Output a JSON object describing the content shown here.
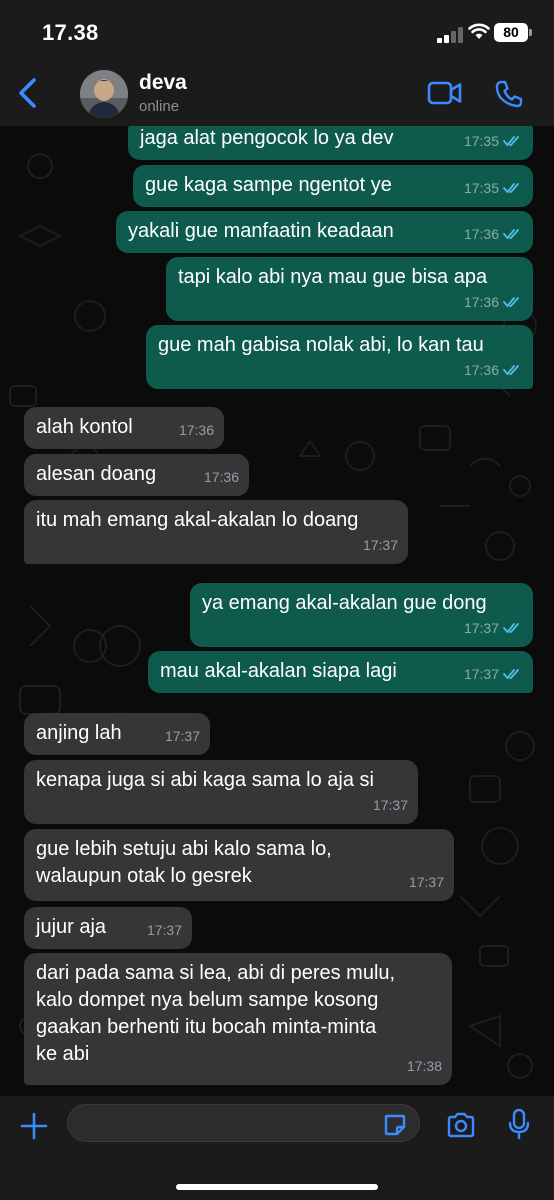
{
  "status_bar": {
    "time": "17.38",
    "battery": "80"
  },
  "header": {
    "contact_name": "deva",
    "contact_status": "online"
  },
  "messages": [
    {
      "dir": "out",
      "text": "jaga alat pengocok lo ya dev",
      "time": "17:35",
      "read": true
    },
    {
      "dir": "out",
      "text": "gue kaga sampe ngentot ye",
      "time": "17:35",
      "read": true
    },
    {
      "dir": "out",
      "text": "yakali gue manfaatin keadaan",
      "time": "17:36",
      "read": true
    },
    {
      "dir": "out",
      "text": "tapi kalo abi nya mau gue bisa apa",
      "time": "17:36",
      "read": true
    },
    {
      "dir": "out",
      "text": "gue mah gabisa nolak abi, lo kan tau",
      "time": "17:36",
      "read": true
    },
    {
      "dir": "in",
      "text": "alah kontol",
      "time": "17:36"
    },
    {
      "dir": "in",
      "text": "alesan doang",
      "time": "17:36"
    },
    {
      "dir": "in",
      "text": "itu mah emang akal-akalan lo doang",
      "time": "17:37"
    },
    {
      "dir": "out",
      "text": "ya emang akal-akalan gue dong",
      "time": "17:37",
      "read": true
    },
    {
      "dir": "out",
      "text": "mau akal-akalan siapa lagi",
      "time": "17:37",
      "read": true
    },
    {
      "dir": "in",
      "text": "anjing lah",
      "time": "17:37"
    },
    {
      "dir": "in",
      "text": "kenapa juga si abi kaga sama lo aja si",
      "time": "17:37"
    },
    {
      "dir": "in",
      "text": "gue lebih setuju abi kalo sama lo,\nwalaupun otak lo gesrek",
      "time": "17:37"
    },
    {
      "dir": "in",
      "text": "jujur aja",
      "time": "17:37"
    },
    {
      "dir": "in",
      "text": "dari pada sama si lea, abi di peres mulu,\nkalo dompet nya belum sampe kosong\ngaakan berhenti itu bocah minta-minta\nke abi",
      "time": "17:38"
    }
  ],
  "colors": {
    "accent": "#3b8bff",
    "outgoing_bubble": "#0e5b4e",
    "incoming_bubble": "#363638",
    "read_ticks": "#53bdeb"
  },
  "icons": [
    "back-chevron-icon",
    "video-call-icon",
    "phone-icon",
    "plus-icon",
    "sticker-icon",
    "camera-icon",
    "microphone-icon",
    "double-check-icon"
  ]
}
